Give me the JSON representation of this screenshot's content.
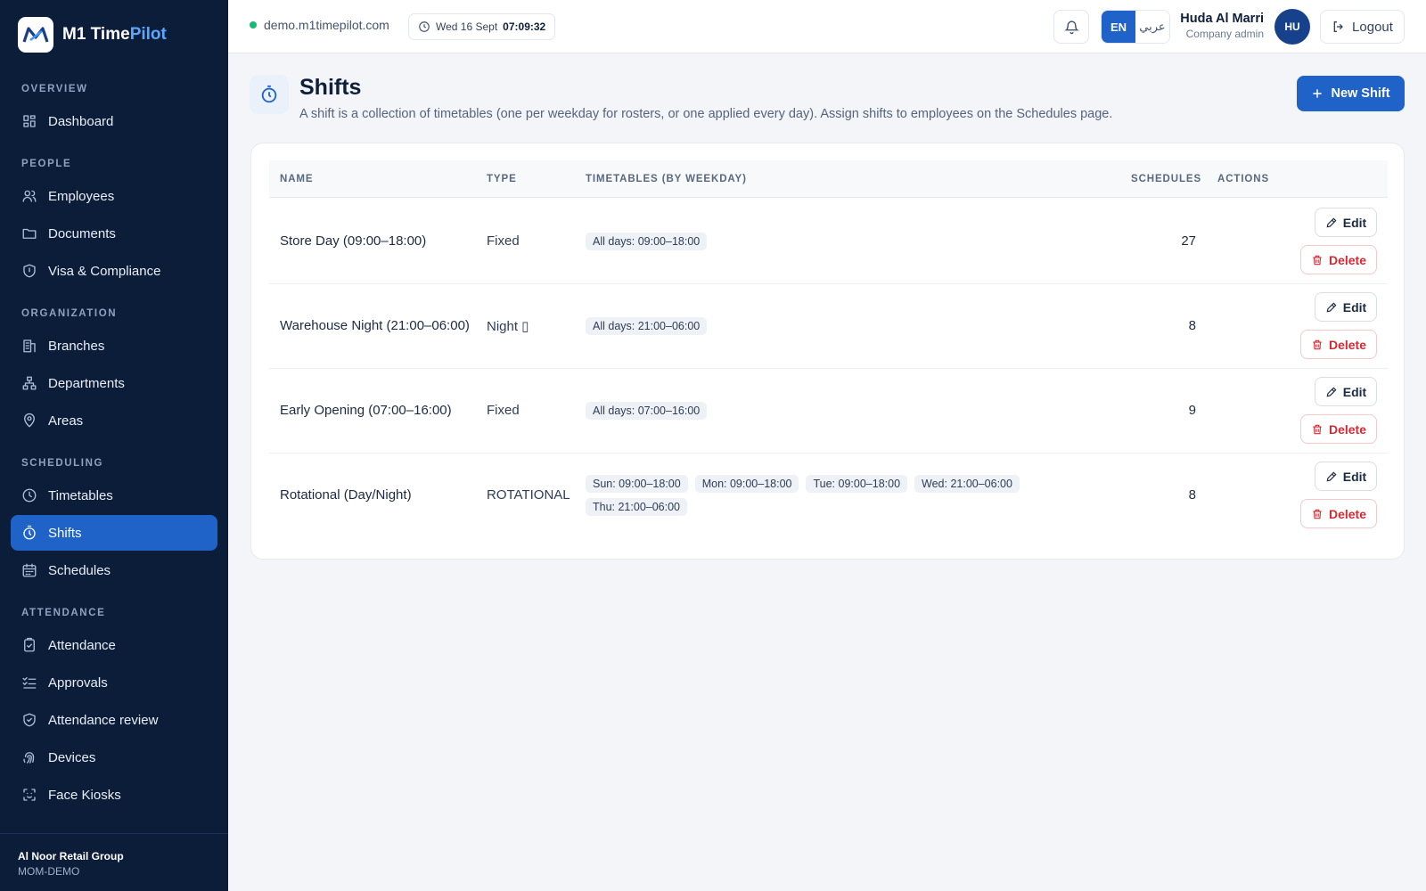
{
  "brand": {
    "name_main": "M1 Time",
    "name_accent": "Pilot"
  },
  "sidebar": {
    "sections": [
      {
        "title": "OVERVIEW",
        "items": [
          {
            "label": "Dashboard",
            "icon": "grid-icon"
          }
        ]
      },
      {
        "title": "PEOPLE",
        "items": [
          {
            "label": "Employees",
            "icon": "users-icon"
          },
          {
            "label": "Documents",
            "icon": "folder-icon"
          },
          {
            "label": "Visa & Compliance",
            "icon": "shield-icon"
          }
        ]
      },
      {
        "title": "ORGANIZATION",
        "items": [
          {
            "label": "Branches",
            "icon": "building-icon"
          },
          {
            "label": "Departments",
            "icon": "hierarchy-icon"
          },
          {
            "label": "Areas",
            "icon": "map-pin-icon"
          }
        ]
      },
      {
        "title": "SCHEDULING",
        "items": [
          {
            "label": "Timetables",
            "icon": "clock-icon"
          },
          {
            "label": "Shifts",
            "icon": "timer-icon",
            "active": true
          },
          {
            "label": "Schedules",
            "icon": "calendar-icon"
          }
        ]
      },
      {
        "title": "ATTENDANCE",
        "items": [
          {
            "label": "Attendance",
            "icon": "clipboard-check-icon"
          },
          {
            "label": "Approvals",
            "icon": "list-check-icon"
          },
          {
            "label": "Attendance review",
            "icon": "shield-check-icon"
          },
          {
            "label": "Devices",
            "icon": "fingerprint-icon"
          },
          {
            "label": "Face Kiosks",
            "icon": "face-scan-icon"
          }
        ]
      }
    ],
    "footer": {
      "org_name": "Al Noor Retail Group",
      "org_code": "MOM-DEMO"
    }
  },
  "topbar": {
    "host": "demo.m1timepilot.com",
    "date": "Wed 16 Sept",
    "time": "07:09:32",
    "lang_en": "EN",
    "lang_ar": "عربي",
    "user_name": "Huda Al Marri",
    "user_role": "Company admin",
    "avatar_initials": "HU",
    "logout_label": "Logout"
  },
  "page": {
    "title": "Shifts",
    "subtitle": "A shift is a collection of timetables (one per weekday for rosters, or one applied every day). Assign shifts to employees on the Schedules page.",
    "new_button": "New Shift"
  },
  "table": {
    "headers": {
      "name": "NAME",
      "type": "TYPE",
      "timetables": "TIMETABLES (BY WEEKDAY)",
      "schedules": "SCHEDULES",
      "actions": "ACTIONS"
    },
    "edit_label": "Edit",
    "delete_label": "Delete",
    "rows": [
      {
        "name": "Store Day (09:00–18:00)",
        "type": "Fixed",
        "timetables": [
          "All days: 09:00–18:00"
        ],
        "schedules": "27"
      },
      {
        "name": "Warehouse Night (21:00–06:00)",
        "type": "Night ▯",
        "timetables": [
          "All days: 21:00–06:00"
        ],
        "schedules": "8"
      },
      {
        "name": "Early Opening (07:00–16:00)",
        "type": "Fixed",
        "timetables": [
          "All days: 07:00–16:00"
        ],
        "schedules": "9"
      },
      {
        "name": "Rotational (Day/Night)",
        "type": "ROTATIONAL",
        "timetables": [
          "Sun: 09:00–18:00",
          "Mon: 09:00–18:00",
          "Tue: 09:00–18:00",
          "Wed: 21:00–06:00",
          "Thu: 21:00–06:00"
        ],
        "schedules": "8"
      }
    ]
  }
}
